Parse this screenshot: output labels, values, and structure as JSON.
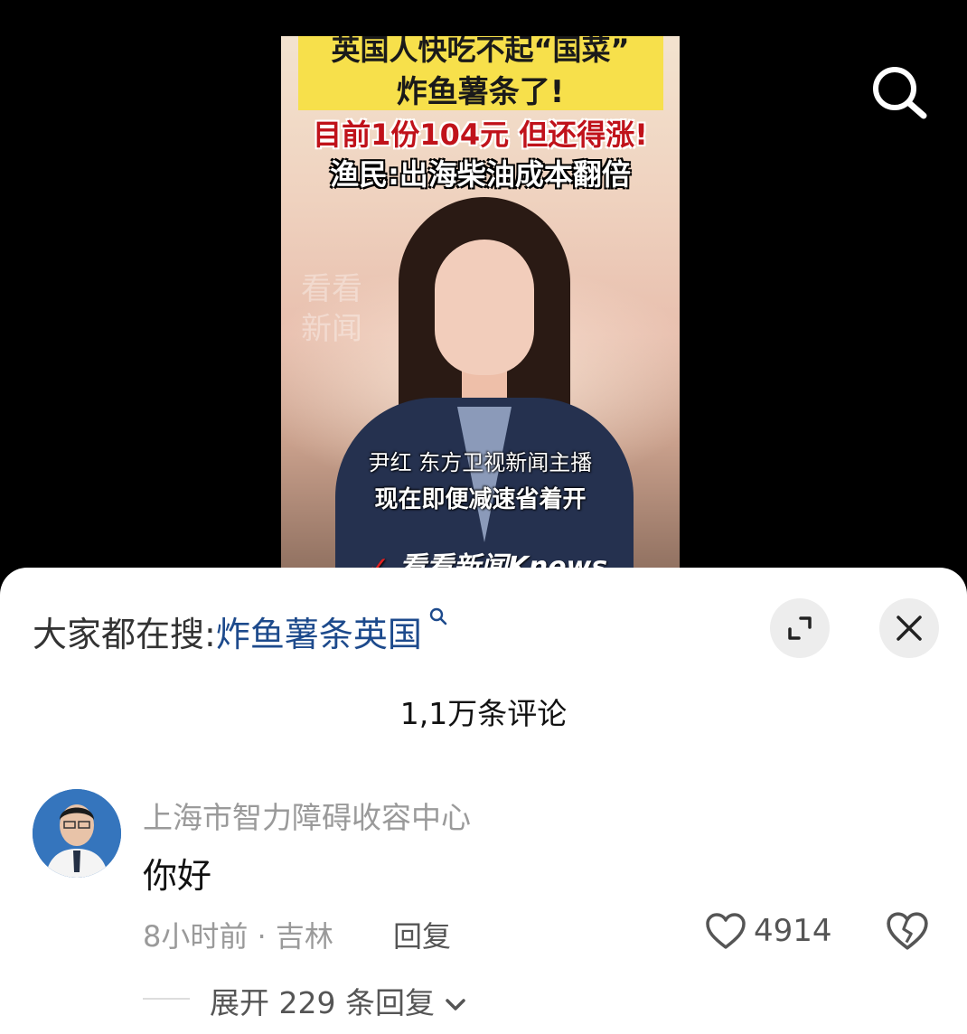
{
  "video": {
    "headline_line1": "英国人快吃不起“国菜”",
    "headline_line2": "炸鱼薯条了!",
    "headline_line3": "目前1份104元  但还得涨!",
    "headline_line4": "渔民:出海柴油成本翻倍",
    "watermark": "看看新闻",
    "caption_name": "尹红 东方卫视新闻主播",
    "caption_line": "现在即便减速省着开",
    "logo_text": "看看新闻Knews"
  },
  "icons": {
    "search": "search-icon",
    "expand": "expand-icon",
    "close": "close-icon",
    "like": "heart-icon",
    "dislike": "broken-heart-icon",
    "chevron": "chevron-down-icon"
  },
  "sheet": {
    "trending_label": "大家都在搜:",
    "trending_term": "炸鱼薯条英国",
    "comment_count": "1,1万条评论"
  },
  "comment": {
    "author": "上海市智力障碍收容中心",
    "text": "你好",
    "meta": "8小时前 · 吉林",
    "reply_label": "回复",
    "likes": "4914",
    "expand_replies": "展开 229 条回复"
  },
  "colors": {
    "accent_link": "#1d4a8c",
    "headline_yellow": "#f7e04b",
    "headline_red": "#c0121a"
  }
}
